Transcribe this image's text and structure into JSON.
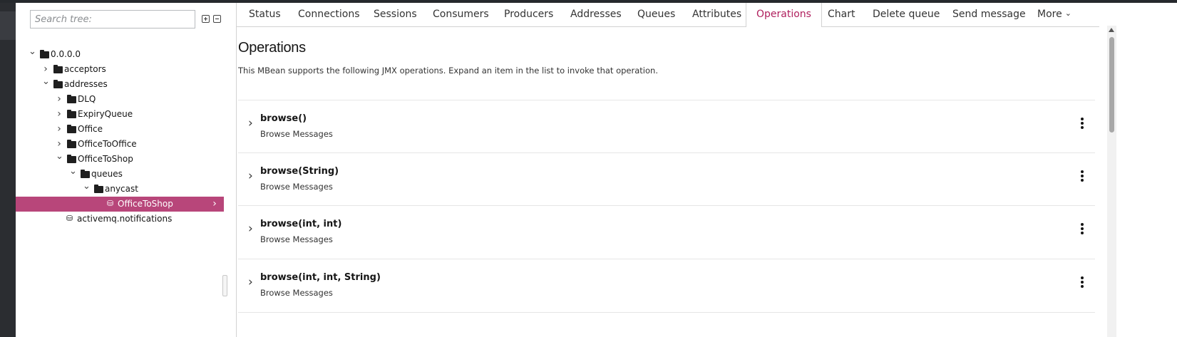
{
  "search": {
    "placeholder": "Search tree:"
  },
  "tree": {
    "nodes": [
      {
        "label": "0.0.0.0",
        "expanded": true,
        "icon": "folder-icon"
      },
      {
        "label": "acceptors",
        "expanded": false,
        "icon": "folder-icon"
      },
      {
        "label": "addresses",
        "expanded": true,
        "icon": "folder-icon"
      },
      {
        "label": "DLQ",
        "expanded": false,
        "icon": "folder-icon"
      },
      {
        "label": "ExpiryQueue",
        "expanded": false,
        "icon": "folder-icon"
      },
      {
        "label": "Office",
        "expanded": false,
        "icon": "folder-icon"
      },
      {
        "label": "OfficeToOffice",
        "expanded": false,
        "icon": "folder-icon"
      },
      {
        "label": "OfficeToShop",
        "expanded": true,
        "icon": "folder-icon"
      },
      {
        "label": "queues",
        "expanded": true,
        "icon": "folder-icon"
      },
      {
        "label": "anycast",
        "expanded": true,
        "icon": "folder-icon"
      },
      {
        "label": "OfficeToShop",
        "selected": true,
        "icon": "cube-icon"
      },
      {
        "label": "activemq.notifications",
        "icon": "cube-icon"
      }
    ]
  },
  "tabs": [
    {
      "label": "Status"
    },
    {
      "label": "Connections"
    },
    {
      "label": "Sessions"
    },
    {
      "label": "Consumers"
    },
    {
      "label": "Producers"
    },
    {
      "label": "Addresses"
    },
    {
      "label": "Queues"
    },
    {
      "label": "Attributes"
    },
    {
      "label": "Operations",
      "active": true
    },
    {
      "label": "Chart"
    },
    {
      "label": "Delete queue"
    },
    {
      "label": "Send message"
    },
    {
      "label": "More"
    }
  ],
  "main": {
    "title": "Operations",
    "description": "This MBean supports the following JMX operations. Expand an item in the list to invoke that operation.",
    "operations": [
      {
        "name": "browse()",
        "description": "Browse Messages"
      },
      {
        "name": "browse(String)",
        "description": "Browse Messages"
      },
      {
        "name": "browse(int, int)",
        "description": "Browse Messages"
      },
      {
        "name": "browse(int, int, String)",
        "description": "Browse Messages"
      }
    ]
  },
  "colors": {
    "accent": "#b8467a",
    "active_tab": "#b0205e",
    "nav": "#2b2d31"
  }
}
